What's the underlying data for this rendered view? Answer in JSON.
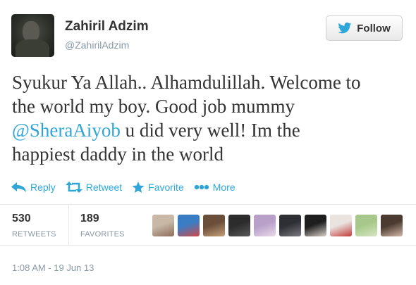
{
  "user": {
    "name": "Zahiril Adzim",
    "handle": "@ZahirilAdzim"
  },
  "follow_button": {
    "label": "Follow"
  },
  "tweet": {
    "line1": "Syukur Ya Allah.. Alhamdulillah. Welcome to",
    "line2": "the world my boy. Good job mummy",
    "mention": "@SheraAiyob",
    "line3_rest": " u did very well! Im the",
    "line4": "happiest daddy in the world"
  },
  "actions": {
    "reply": "Reply",
    "retweet": "Retweet",
    "favorite": "Favorite",
    "more": "More"
  },
  "stats": {
    "retweets_count": "530",
    "retweets_label": "RETWEETS",
    "favorites_count": "189",
    "favorites_label": "FAVORITES"
  },
  "favoriters": [
    {
      "colors": [
        "#c9b8a6",
        "#8c6e5a"
      ]
    },
    {
      "colors": [
        "#3a7dc4",
        "#d14848"
      ]
    },
    {
      "colors": [
        "#6b4e3a",
        "#c7a07a"
      ]
    },
    {
      "colors": [
        "#2c2c2c",
        "#5a5a5a"
      ]
    },
    {
      "colors": [
        "#b9a0c9",
        "#e8d8e8"
      ]
    },
    {
      "colors": [
        "#2e2e35",
        "#7a7a80"
      ]
    },
    {
      "colors": [
        "#1e1e1e",
        "#d9d0c8"
      ]
    },
    {
      "colors": [
        "#e9e4e0",
        "#c43b3b"
      ]
    },
    {
      "colors": [
        "#a7c88a",
        "#d6e6c2"
      ]
    },
    {
      "colors": [
        "#4a3a30",
        "#d4b8a8"
      ]
    }
  ],
  "timestamp": "1:08 AM - 19 Jun 13",
  "colors": {
    "link_blue": "#2fa6d8",
    "muted_gray": "#8899a6",
    "text": "#333333"
  }
}
